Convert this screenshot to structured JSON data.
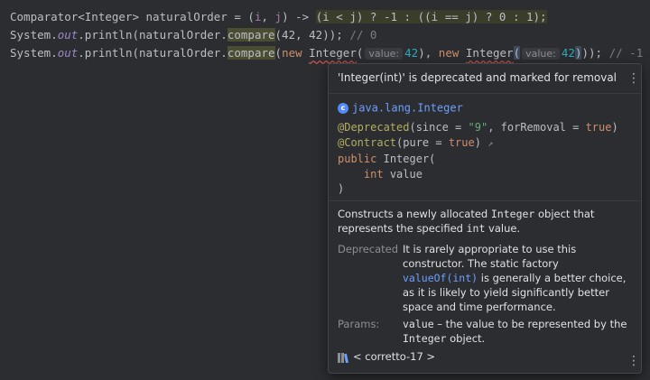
{
  "editor": {
    "line1": {
      "decl": "Comparator<Integer> naturalOrder = (",
      "param_i": "i",
      "sep": ", ",
      "param_j": "j",
      "arrow": ") -> ",
      "body": "(i < j) ? -1 : ((i == j) ? 0 : 1);"
    },
    "line2": {
      "system": "System.",
      "out": "out",
      "println": ".println(naturalOrder.",
      "compare": "compare",
      "args": "(42, 42)); ",
      "comment": "// 0"
    },
    "line3": {
      "system": "System.",
      "out": "out",
      "println": ".println(naturalOrder.",
      "compare": "compare",
      "open": "(",
      "new1": "new",
      "ctor1": "Integer",
      "open1": "(",
      "hint1": "value:",
      "val1": "42",
      "close1": "), ",
      "new2": "new",
      "ctor2": "Integer",
      "open2": "(",
      "hint2": "value:",
      "val2a": "42",
      "val2b": ")",
      "close2": ")); ",
      "comment": "// -1"
    }
  },
  "popup": {
    "title": "'Integer(int)' is deprecated and marked for removal",
    "class_name": "java.lang.Integer",
    "signature": {
      "anno1": "@Deprecated",
      "anno1_args_a": "(since = ",
      "anno1_since": "\"9\"",
      "anno1_args_b": ", forRemoval = ",
      "anno1_true": "true",
      "anno1_close": ")",
      "anno2": "@Contract",
      "anno2_args_a": "(pure = ",
      "anno2_true": "true",
      "anno2_close": ")",
      "anno2_arrow": "↗",
      "public_kw": "public",
      "ctor_name": "Integer",
      "ctor_open": "(",
      "param_type": "int",
      "param_name": "value",
      "ctor_close": ")"
    },
    "description": {
      "part1": "Constructs a newly allocated ",
      "code1": "Integer",
      "part2": " object that represents the specified ",
      "code2": "int",
      "part3": " value."
    },
    "deprecated": {
      "label": "Deprecated",
      "part1": "It is rarely appropriate to use this constructor. The static factory ",
      "link": "valueOf(int)",
      "part2": " is generally a better choice, as it is likely to yield significantly better space and time performance."
    },
    "params": {
      "label": "Params:",
      "name": "value",
      "part1": " – the value to be represented by the ",
      "code": "Integer",
      "part2": " object."
    },
    "footer": {
      "icon": "library-icon",
      "text": "< corretto-17 >"
    },
    "menu_icon": "⋮"
  },
  "colors": {
    "background": "#2b2d30",
    "keyword": "#cf8e6d",
    "number": "#2aacb8",
    "annotation": "#b3ae60",
    "link": "#6e9fff",
    "error_underline": "#c75450"
  }
}
